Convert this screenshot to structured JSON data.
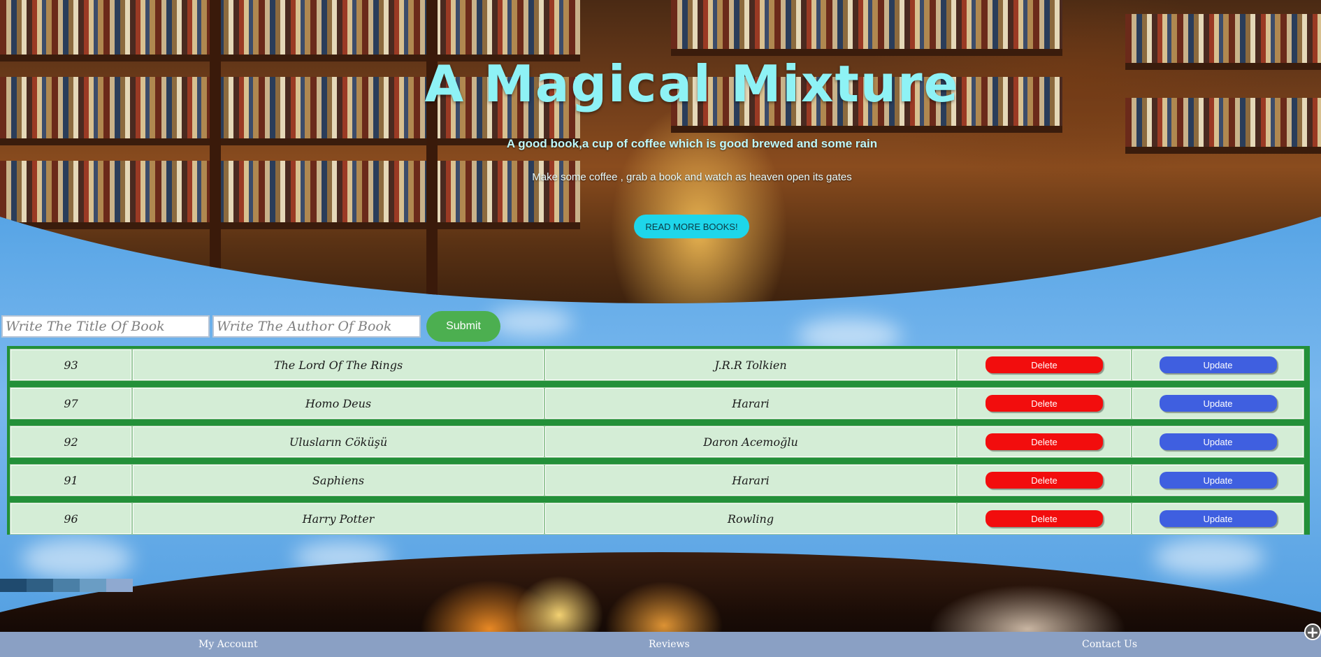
{
  "hero": {
    "title": "A Magical Mixture",
    "subtitle": "A good book,a cup of coffee which is good brewed and some rain",
    "description": "Make some coffee , grab a book and watch as heaven open its gates",
    "button_label": "READ MORE BOOKS!"
  },
  "form": {
    "title_placeholder": "Write The Title Of Book",
    "author_placeholder": "Write The Author Of Book",
    "submit_label": "Submit"
  },
  "books": [
    {
      "id": "93",
      "title": "The Lord Of The Rings",
      "author": "J.R.R Tolkien",
      "delete_label": "Delete",
      "update_label": "Update"
    },
    {
      "id": "97",
      "title": "Homo Deus",
      "author": "Harari",
      "delete_label": "Delete",
      "update_label": "Update"
    },
    {
      "id": "92",
      "title": "Ulusların Cöküşü",
      "author": "Daron Acemoğlu",
      "delete_label": "Delete",
      "update_label": "Update"
    },
    {
      "id": "91",
      "title": "Saphiens",
      "author": "Harari",
      "delete_label": "Delete",
      "update_label": "Update"
    },
    {
      "id": "96",
      "title": "Harry Potter",
      "author": "Rowling",
      "delete_label": "Delete",
      "update_label": "Update"
    }
  ],
  "palette": [
    "#1f4a6e",
    "#2f5f84",
    "#4a7fa6",
    "#6a9dc4",
    "#8fa9d0"
  ],
  "footer": {
    "links": [
      "My Account",
      "Reviews",
      "Contact Us"
    ]
  },
  "icons": {
    "corner": "plus-icon"
  },
  "colors": {
    "title": "#8ef2f5",
    "read_more": "#1ed6ea",
    "submit": "#4caf50",
    "table_border": "#239039",
    "delete": "#f20d0d",
    "update": "#3f5fe0",
    "footer": "#8aa0c4"
  }
}
